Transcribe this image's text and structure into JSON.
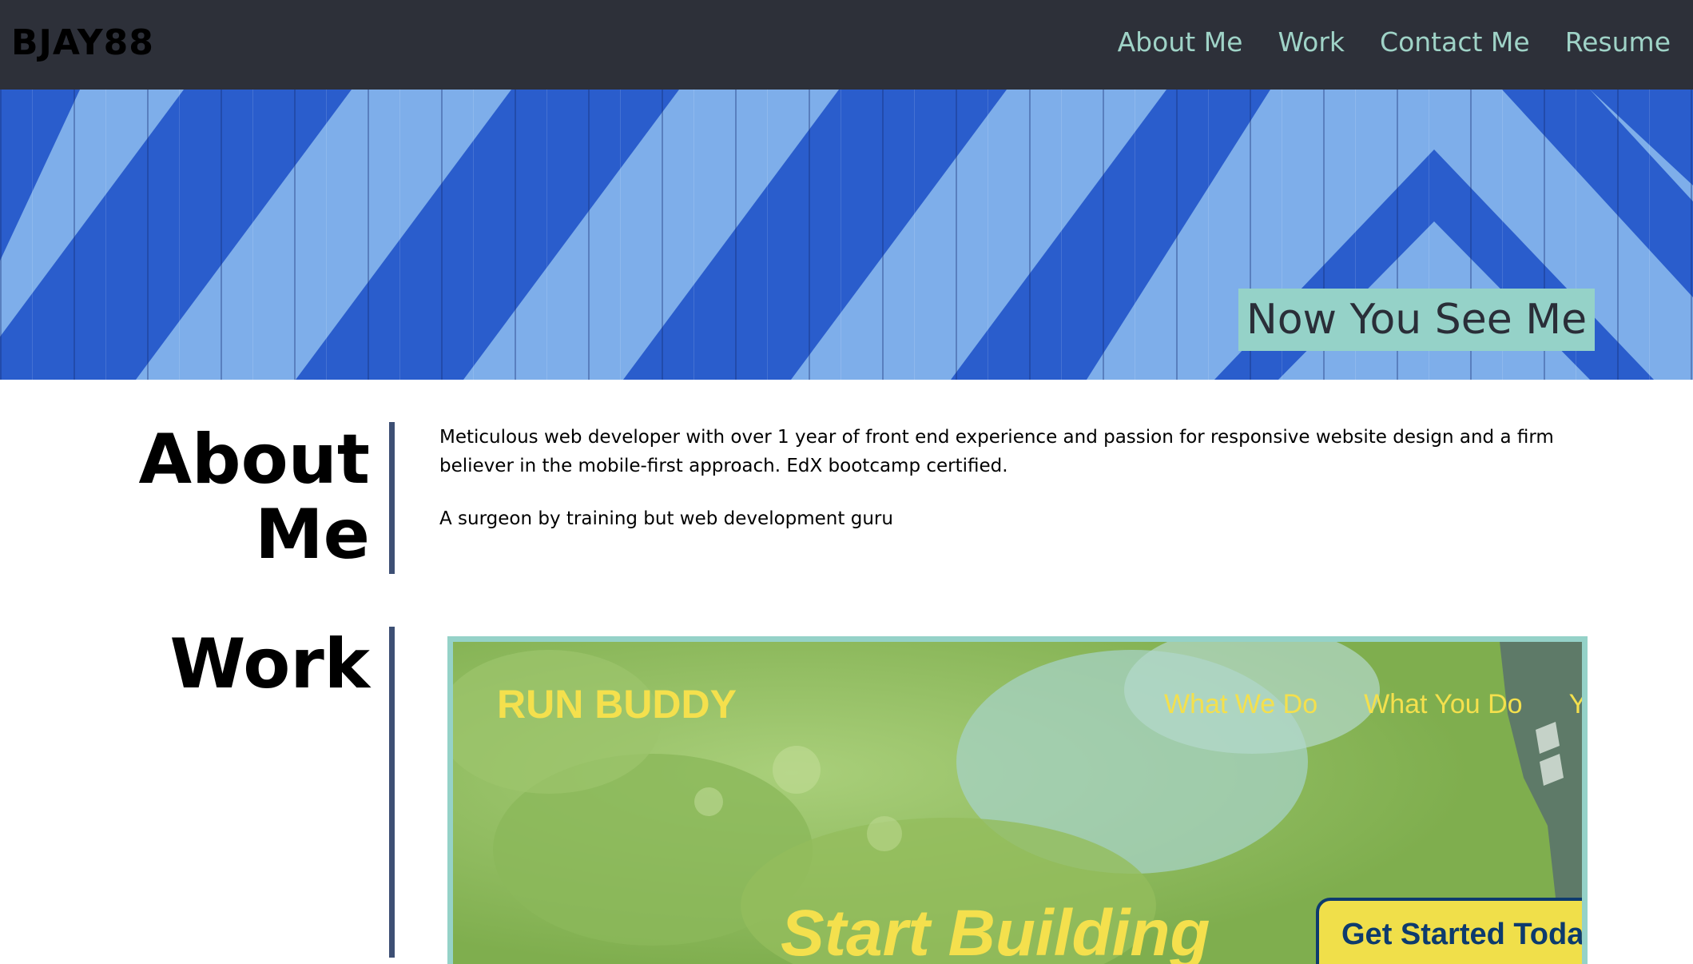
{
  "header": {
    "logo": "BJAY88",
    "nav": [
      "About Me",
      "Work",
      "Contact Me",
      "Resume"
    ]
  },
  "hero": {
    "title": "Now You See Me"
  },
  "about": {
    "heading_line1": "About",
    "heading_line2": "Me",
    "paragraph1": "Meticulous web developer with over 1 year of front end experience and passion for responsive website design and a firm believer in the mobile-first approach. EdX bootcamp certified.",
    "paragraph2": "A surgeon by training but web development guru"
  },
  "work": {
    "heading": "Work",
    "project": {
      "brand": "RUN BUDDY",
      "nav": [
        "What We Do",
        "What You Do",
        "Yo"
      ],
      "hero_text": "Start Building",
      "cta_title": "Get Started Today"
    }
  },
  "colors": {
    "header_bg": "#2d3039",
    "nav_link": "#9fd3c7",
    "hero_title_bg": "#95d2c8",
    "divider": "#3d4f74",
    "project_yellow": "#f4e04d",
    "project_navy": "#0d3b6e"
  }
}
